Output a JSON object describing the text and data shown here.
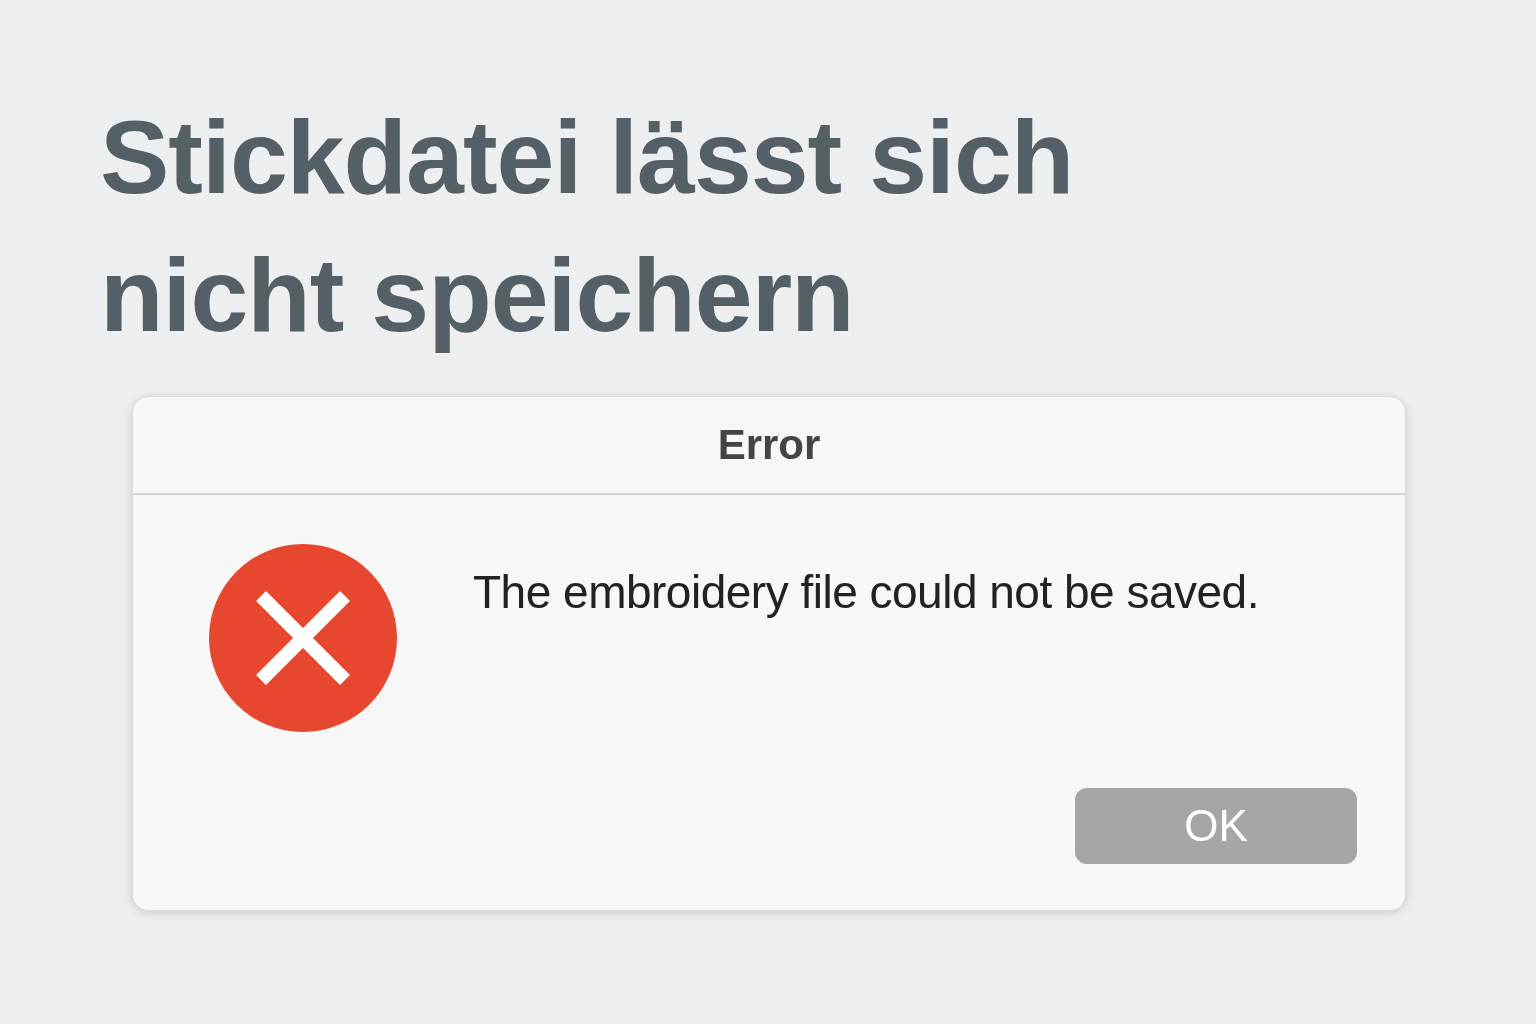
{
  "heading": "Stickdatei lässt sich nicht speichern",
  "dialog": {
    "title": "Error",
    "message": "The embroidery file could not be saved.",
    "kind": "error",
    "buttons": [
      "OK"
    ]
  }
}
